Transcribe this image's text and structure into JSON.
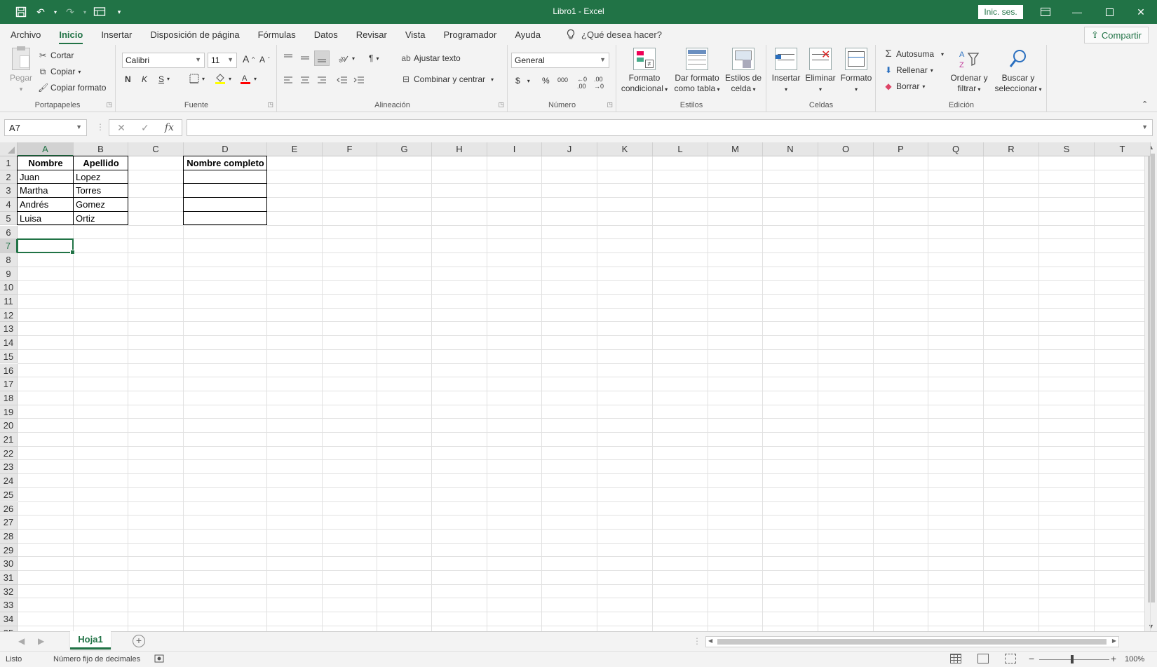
{
  "window": {
    "title": "Libro1  -  Excel",
    "signin_label": "Inic. ses.",
    "share_label": "Compartir"
  },
  "tabs": [
    "Archivo",
    "Inicio",
    "Insertar",
    "Disposición de página",
    "Fórmulas",
    "Datos",
    "Revisar",
    "Vista",
    "Programador",
    "Ayuda"
  ],
  "active_tab": "Inicio",
  "tell_me": "¿Qué desea hacer?",
  "ribbon": {
    "clipboard": {
      "paste": "Pegar",
      "cut": "Cortar",
      "copy": "Copiar",
      "format_painter": "Copiar formato",
      "label": "Portapapeles"
    },
    "font": {
      "family": "Calibri",
      "size": "11",
      "bold": "N",
      "italic": "K",
      "underline": "S",
      "label": "Fuente"
    },
    "alignment": {
      "wrap": "Ajustar texto",
      "merge": "Combinar y centrar",
      "label": "Alineación"
    },
    "number": {
      "format": "General",
      "currency": "$",
      "percent": "%",
      "thousands": "000",
      "label": "Número"
    },
    "styles": {
      "conditional": [
        "Formato",
        "condicional"
      ],
      "as_table": [
        "Dar formato",
        "como tabla"
      ],
      "cell_styles": [
        "Estilos de",
        "celda"
      ],
      "label": "Estilos"
    },
    "cells": {
      "insert": "Insertar",
      "delete": "Eliminar",
      "format": "Formato",
      "label": "Celdas"
    },
    "editing": {
      "autosum": "Autosuma",
      "fill": "Rellenar",
      "clear": "Borrar",
      "sort": [
        "Ordenar y",
        "filtrar"
      ],
      "find": [
        "Buscar y",
        "seleccionar"
      ],
      "label": "Edición"
    }
  },
  "formula_bar": {
    "name_box": "A7",
    "cancel": "✕",
    "enter": "✓",
    "fx": "fx",
    "content": ""
  },
  "columns": [
    "A",
    "B",
    "C",
    "D",
    "E",
    "F",
    "G",
    "H",
    "I",
    "J",
    "K",
    "L",
    "M",
    "N",
    "O",
    "P",
    "Q",
    "R",
    "S",
    "T"
  ],
  "rows": [
    "1",
    "2",
    "3",
    "4",
    "5",
    "6",
    "7",
    "8",
    "9",
    "10",
    "11",
    "12",
    "13",
    "14",
    "15",
    "16",
    "17",
    "18",
    "19",
    "20",
    "21",
    "22",
    "23",
    "24",
    "25",
    "26",
    "27",
    "28",
    "29",
    "30",
    "31",
    "32",
    "33",
    "34",
    "35"
  ],
  "active_cell": {
    "col": "A",
    "row": "7"
  },
  "cells": {
    "A1": "Nombre",
    "B1": "Apellido",
    "D1": "Nombre completo",
    "A2": "Juan",
    "B2": "Lopez",
    "A3": "Martha",
    "B3": "Torres",
    "A4": "Andrés",
    "B4": " Gomez",
    "A5": "Luisa",
    "B5": "Ortiz"
  },
  "sheets": [
    "Hoja1"
  ],
  "status": {
    "ready": "Listo",
    "mode": "Número fijo de decimales",
    "zoom": "100%"
  },
  "colors": {
    "accent": "#217346",
    "grid": "#e1e1e1"
  }
}
